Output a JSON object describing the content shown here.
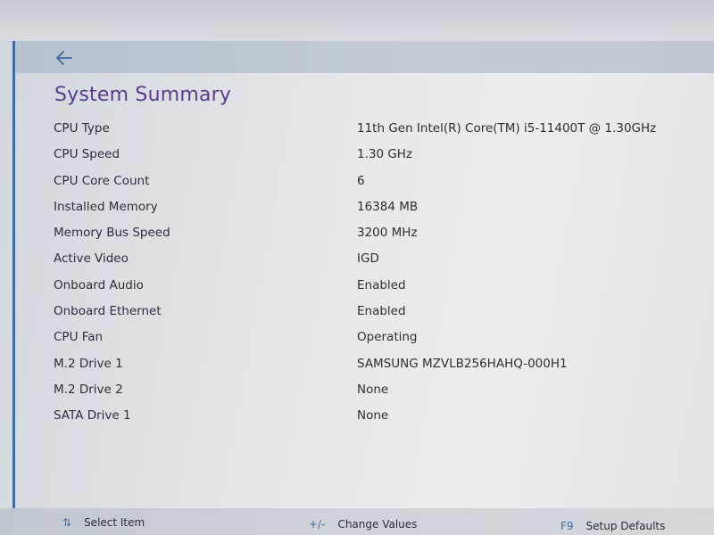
{
  "header": {
    "back_icon": "arrow-left-icon"
  },
  "page": {
    "title": "System Summary"
  },
  "summary": [
    {
      "label": "CPU Type",
      "value": "11th Gen Intel(R) Core(TM) i5-11400T @ 1.30GHz"
    },
    {
      "label": "CPU Speed",
      "value": "1.30 GHz"
    },
    {
      "label": "CPU Core Count",
      "value": "6"
    },
    {
      "label": "Installed Memory",
      "value": "16384 MB"
    },
    {
      "label": "Memory Bus Speed",
      "value": "3200 MHz"
    },
    {
      "label": "Active Video",
      "value": "IGD"
    },
    {
      "label": "Onboard Audio",
      "value": "Enabled"
    },
    {
      "label": "Onboard Ethernet",
      "value": "Enabled"
    },
    {
      "label": "CPU Fan",
      "value": "Operating"
    },
    {
      "label": "M.2 Drive 1",
      "value": "SAMSUNG MZVLB256HAHQ-000H1"
    },
    {
      "label": "M.2 Drive 2",
      "value": "None"
    },
    {
      "label": "SATA Drive 1",
      "value": "None"
    }
  ],
  "footer": {
    "select_key": "⇅",
    "select_label": "Select Item",
    "change_key": "+/-",
    "change_label": "Change Values",
    "defaults_key": "F9",
    "defaults_label": "Setup Defaults"
  },
  "colors": {
    "title": "#5b3b91",
    "accent": "#3f6aa3",
    "text": "#2b2f36"
  }
}
